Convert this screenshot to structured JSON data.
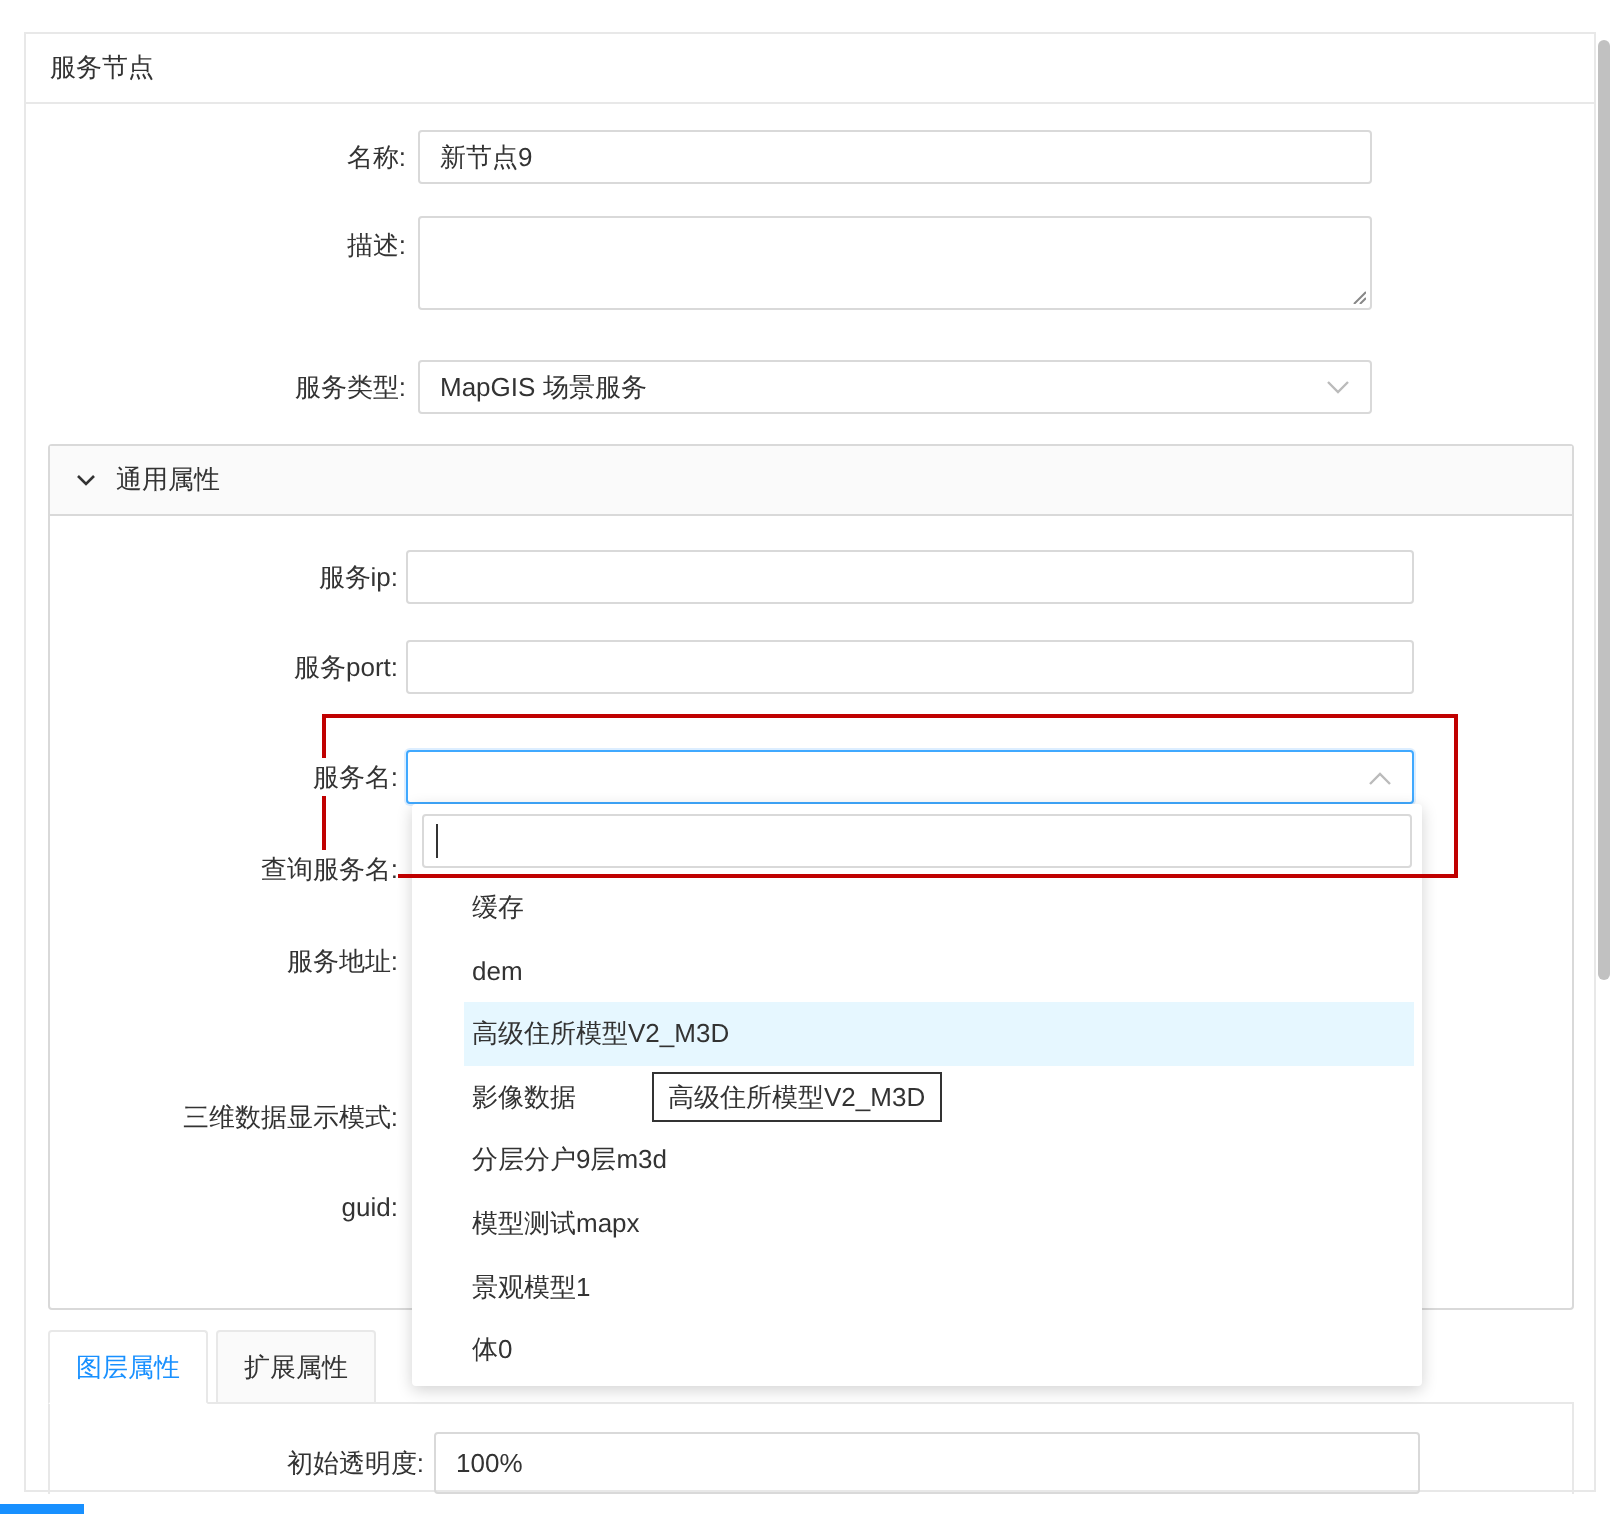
{
  "panel_title": "服务节点",
  "form": [
    {
      "label": "名称:",
      "kind": "input",
      "value": "新节点9"
    },
    {
      "label": "描述:",
      "kind": "textarea"
    },
    {
      "label": "服务类型:",
      "kind": "select",
      "value": "MapGIS 场景服务"
    }
  ],
  "section": {
    "title": "通用属性",
    "expanded": true,
    "fields": [
      {
        "label": "服务ip:",
        "kind": "input"
      },
      {
        "label": "服务port:",
        "kind": "input"
      },
      {
        "label": "服务名:",
        "kind": "select",
        "focused": true
      },
      {
        "label": "查询服务名:"
      },
      {
        "label": "服务地址:"
      },
      {
        "label": "三维数据显示模式:"
      },
      {
        "label": "guid:"
      }
    ]
  },
  "dropdown": {
    "items": [
      {
        "label": "缓存",
        "hovered": false
      },
      {
        "label": "dem",
        "hovered": false
      },
      {
        "label": "高级住所模型V2_M3D",
        "hovered": true
      },
      {
        "label": "影像数据",
        "hovered": false
      },
      {
        "label": "分层分户9层m3d",
        "hovered": false
      },
      {
        "label": "模型测试mapx",
        "hovered": false
      },
      {
        "label": "景观模型1",
        "hovered": false
      },
      {
        "label": "体0",
        "hovered": false
      }
    ],
    "tooltip": "高级住所模型V2_M3D"
  },
  "tabs": [
    {
      "label": "图层属性",
      "selected": true
    },
    {
      "label": "扩展属性",
      "selected": false
    }
  ],
  "tab_fields": [
    {
      "label": "初始透明度:",
      "value": "100%"
    }
  ]
}
